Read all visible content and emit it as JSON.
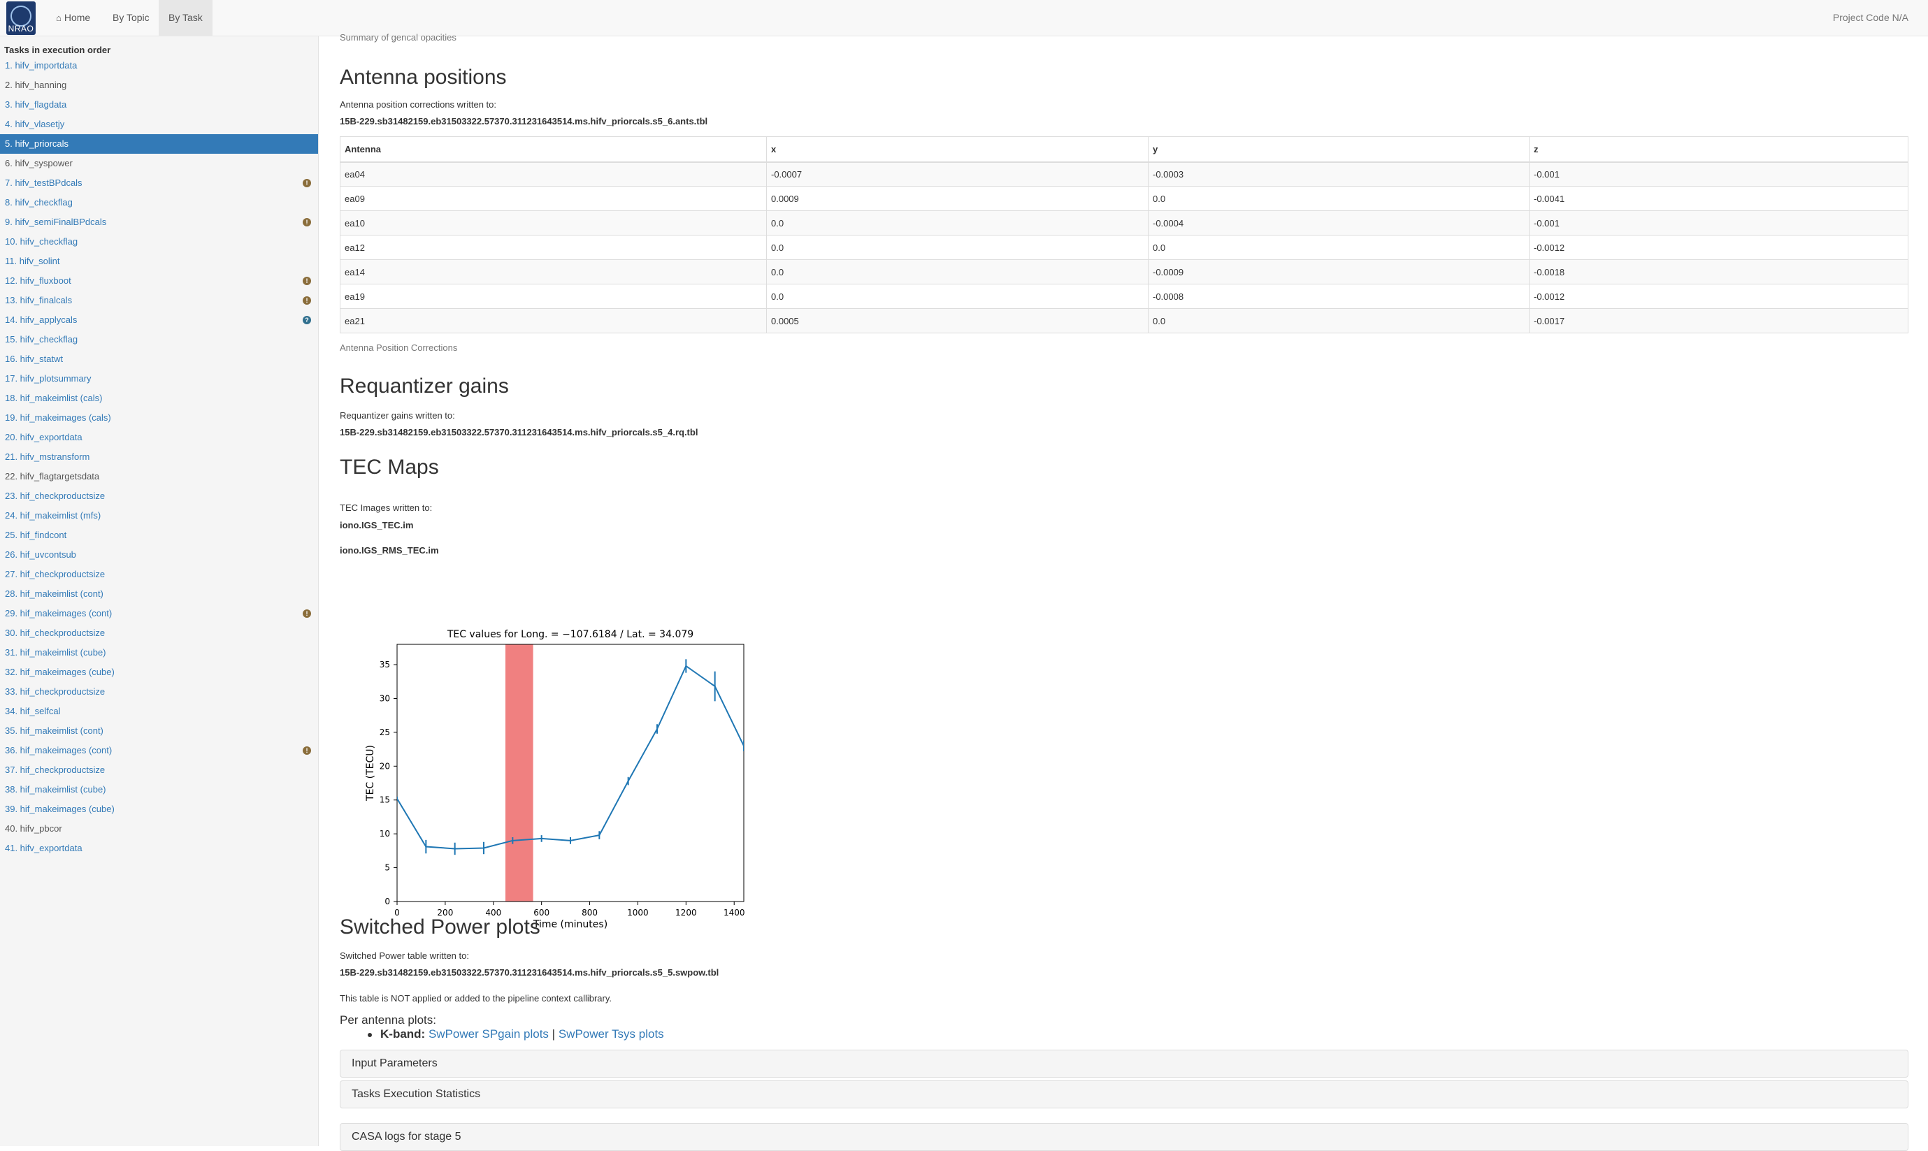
{
  "nav": {
    "logo_text": "NRAO",
    "home": "Home",
    "by_topic": "By Topic",
    "by_task": "By Task",
    "project_code": "Project Code N/A"
  },
  "sidebar": {
    "title": "Tasks in execution order",
    "items": [
      {
        "label": "1. hifv_importdata",
        "style": "link",
        "badge": ""
      },
      {
        "label": "2. hifv_hanning",
        "style": "plain",
        "badge": ""
      },
      {
        "label": "3. hifv_flagdata",
        "style": "link",
        "badge": ""
      },
      {
        "label": "4. hifv_vlasetjy",
        "style": "link",
        "badge": ""
      },
      {
        "label": "5. hifv_priorcals",
        "style": "active",
        "badge": ""
      },
      {
        "label": "6. hifv_syspower",
        "style": "plain",
        "badge": ""
      },
      {
        "label": "7. hifv_testBPdcals",
        "style": "link",
        "badge": "warn"
      },
      {
        "label": "8. hifv_checkflag",
        "style": "link",
        "badge": ""
      },
      {
        "label": "9. hifv_semiFinalBPdcals",
        "style": "link",
        "badge": "warn"
      },
      {
        "label": "10. hifv_checkflag",
        "style": "link",
        "badge": ""
      },
      {
        "label": "11. hifv_solint",
        "style": "link",
        "badge": ""
      },
      {
        "label": "12. hifv_fluxboot",
        "style": "link",
        "badge": "warn"
      },
      {
        "label": "13. hifv_finalcals",
        "style": "link",
        "badge": "warn"
      },
      {
        "label": "14. hifv_applycals",
        "style": "link",
        "badge": "info"
      },
      {
        "label": "15. hifv_checkflag",
        "style": "link",
        "badge": ""
      },
      {
        "label": "16. hifv_statwt",
        "style": "link",
        "badge": ""
      },
      {
        "label": "17. hifv_plotsummary",
        "style": "link",
        "badge": ""
      },
      {
        "label": "18. hif_makeimlist (cals)",
        "style": "link",
        "badge": ""
      },
      {
        "label": "19. hif_makeimages (cals)",
        "style": "link",
        "badge": ""
      },
      {
        "label": "20. hifv_exportdata",
        "style": "link",
        "badge": ""
      },
      {
        "label": "21. hifv_mstransform",
        "style": "link",
        "badge": ""
      },
      {
        "label": "22. hifv_flagtargetsdata",
        "style": "plain",
        "badge": ""
      },
      {
        "label": "23. hif_checkproductsize",
        "style": "link",
        "badge": ""
      },
      {
        "label": "24. hif_makeimlist (mfs)",
        "style": "link",
        "badge": ""
      },
      {
        "label": "25. hif_findcont",
        "style": "link",
        "badge": ""
      },
      {
        "label": "26. hif_uvcontsub",
        "style": "link",
        "badge": ""
      },
      {
        "label": "27. hif_checkproductsize",
        "style": "link",
        "badge": ""
      },
      {
        "label": "28. hif_makeimlist (cont)",
        "style": "link",
        "badge": ""
      },
      {
        "label": "29. hif_makeimages (cont)",
        "style": "link",
        "badge": "warn"
      },
      {
        "label": "30. hif_checkproductsize",
        "style": "link",
        "badge": ""
      },
      {
        "label": "31. hif_makeimlist (cube)",
        "style": "link",
        "badge": ""
      },
      {
        "label": "32. hif_makeimages (cube)",
        "style": "link",
        "badge": ""
      },
      {
        "label": "33. hif_checkproductsize",
        "style": "link",
        "badge": ""
      },
      {
        "label": "34. hif_selfcal",
        "style": "link",
        "badge": ""
      },
      {
        "label": "35. hif_makeimlist (cont)",
        "style": "link",
        "badge": ""
      },
      {
        "label": "36. hif_makeimages (cont)",
        "style": "link",
        "badge": "warn"
      },
      {
        "label": "37. hif_checkproductsize",
        "style": "link",
        "badge": ""
      },
      {
        "label": "38. hif_makeimlist (cube)",
        "style": "link",
        "badge": ""
      },
      {
        "label": "39. hif_makeimages (cube)",
        "style": "link",
        "badge": ""
      },
      {
        "label": "40. hifv_pbcor",
        "style": "plain",
        "badge": ""
      },
      {
        "label": "41. hifv_exportdata",
        "style": "link",
        "badge": ""
      }
    ]
  },
  "main": {
    "cut_text": "Summary of gencal opacities",
    "antenna": {
      "heading": "Antenna positions",
      "written_label": "Antenna position corrections written to:",
      "file": "15B-229.sb31482159.eb31503322.57370.311231643514.ms.hifv_priorcals.s5_6.ants.tbl",
      "columns": [
        "Antenna",
        "x",
        "y",
        "z"
      ],
      "rows": [
        [
          "ea04",
          "-0.0007",
          "-0.0003",
          "-0.001"
        ],
        [
          "ea09",
          "0.0009",
          "0.0",
          "-0.0041"
        ],
        [
          "ea10",
          "0.0",
          "-0.0004",
          "-0.001"
        ],
        [
          "ea12",
          "0.0",
          "0.0",
          "-0.0012"
        ],
        [
          "ea14",
          "0.0",
          "-0.0009",
          "-0.0018"
        ],
        [
          "ea19",
          "0.0",
          "-0.0008",
          "-0.0012"
        ],
        [
          "ea21",
          "0.0005",
          "0.0",
          "-0.0017"
        ]
      ],
      "caption": "Antenna Position Corrections"
    },
    "requantizer": {
      "heading": "Requantizer gains",
      "written_label": "Requantizer gains written to:",
      "file": "15B-229.sb31482159.eb31503322.57370.311231643514.ms.hifv_priorcals.s5_4.rq.tbl"
    },
    "tec": {
      "heading": "TEC Maps",
      "written_label": "TEC Images written to:",
      "file1": "iono.IGS_TEC.im",
      "file2": "iono.IGS_RMS_TEC.im"
    },
    "swpow": {
      "heading": "Switched Power plots",
      "written_label": "Switched Power table written to:",
      "file": "15B-229.sb31482159.eb31503322.57370.311231643514.ms.hifv_priorcals.s5_5.swpow.tbl",
      "note": "This table is NOT applied or added to the pipeline context callibrary.",
      "per_antenna": "Per antenna plots:",
      "band_label": "K-band:",
      "link1": "SwPower SPgain plots",
      "separator": "|",
      "link2": "SwPower Tsys plots"
    },
    "panels": {
      "input_params": "Input Parameters",
      "exec_stats": "Tasks Execution Statistics",
      "casa_logs": "CASA logs for stage 5"
    }
  },
  "chart_data": {
    "type": "line",
    "title": "TEC values for Long.  = −107.6184 / Lat.  = 34.079",
    "xlabel": "Time (minutes)",
    "ylabel": "TEC (TECU)",
    "xlim": [
      0,
      1440
    ],
    "ylim": [
      0,
      38
    ],
    "xticks": [
      0,
      200,
      400,
      600,
      800,
      1000,
      1200,
      1400
    ],
    "yticks": [
      0,
      5,
      10,
      15,
      20,
      25,
      30,
      35
    ],
    "series": [
      {
        "x": [
          0,
          120,
          240,
          360,
          480,
          600,
          720,
          840,
          960,
          1080,
          1200,
          1320,
          1440
        ],
        "y": [
          15.2,
          8.1,
          7.8,
          7.9,
          9.0,
          9.3,
          9.0,
          9.8,
          17.8,
          25.5,
          34.8,
          31.8,
          23.0
        ],
        "err": [
          0.3,
          1.0,
          0.9,
          0.9,
          0.5,
          0.5,
          0.5,
          0.6,
          0.6,
          0.7,
          1.0,
          2.2,
          0.8
        ],
        "color": "#1f77b4"
      }
    ],
    "highlight_span": {
      "x0": 450,
      "x1": 565,
      "color": "#f08080"
    }
  }
}
